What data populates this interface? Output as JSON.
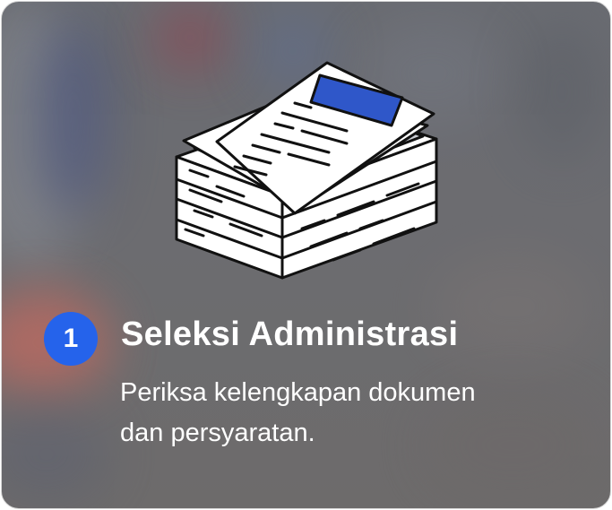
{
  "step": {
    "number": "1",
    "title": "Seleksi Administrasi",
    "description_lines": [
      "Periksa kelengkapan dokumen",
      "dan persyaratan."
    ]
  },
  "illustration": {
    "icon": "document-stack-icon",
    "accent_color": "#2f57c9"
  },
  "colors": {
    "badge": "#2563eb",
    "text": "#ffffff",
    "card_background": "#6b6c70"
  }
}
